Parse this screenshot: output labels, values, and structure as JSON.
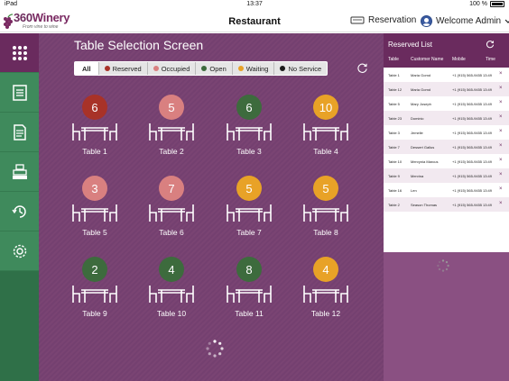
{
  "status_bar": {
    "device": "iPad",
    "time": "13:37",
    "battery": "100 %"
  },
  "header": {
    "logo_prefix": "360",
    "logo_name": "Winery",
    "logo_tagline": "From vine to wine",
    "title": "Restaurant",
    "reservation_label": "Reservation",
    "admin_label": "Welcome Admin"
  },
  "sidebar": {
    "items": [
      {
        "name": "grid-icon",
        "active": true
      },
      {
        "name": "list-icon",
        "active": false
      },
      {
        "name": "document-icon",
        "active": false
      },
      {
        "name": "register-icon",
        "active": false
      },
      {
        "name": "history-icon",
        "active": false
      },
      {
        "name": "gear-icon",
        "active": false
      }
    ]
  },
  "main": {
    "title": "Table Selection Screen",
    "filters": [
      {
        "label": "All",
        "color": null,
        "active": true
      },
      {
        "label": "Reserved",
        "color": "#a83228",
        "active": false
      },
      {
        "label": "Occupied",
        "color": "#d98080",
        "active": false
      },
      {
        "label": "Open",
        "color": "#3d6b3d",
        "active": false
      },
      {
        "label": "Waiting",
        "color": "#e8a227",
        "active": false
      },
      {
        "label": "No Service",
        "color": "#1a1a1a",
        "active": false
      }
    ],
    "tables": [
      {
        "count": "6",
        "name": "Table 1",
        "color": "#a83228"
      },
      {
        "count": "5",
        "name": "Table 2",
        "color": "#d98080"
      },
      {
        "count": "6",
        "name": "Table 3",
        "color": "#3d6b3d"
      },
      {
        "count": "10",
        "name": "Table 4",
        "color": "#e8a227"
      },
      {
        "count": "3",
        "name": "Table 5",
        "color": "#d98080"
      },
      {
        "count": "7",
        "name": "Table 6",
        "color": "#d98080"
      },
      {
        "count": "5",
        "name": "Table 7",
        "color": "#e8a227"
      },
      {
        "count": "5",
        "name": "Table 8",
        "color": "#e8a227"
      },
      {
        "count": "2",
        "name": "Table 9",
        "color": "#3d6b3d"
      },
      {
        "count": "4",
        "name": "Table 10",
        "color": "#3d6b3d"
      },
      {
        "count": "8",
        "name": "Table 11",
        "color": "#3d6b3d"
      },
      {
        "count": "4",
        "name": "Table 12",
        "color": "#e8a227"
      }
    ]
  },
  "reserved": {
    "title": "Reserved List",
    "columns": [
      "Table",
      "Customer Name",
      "Mobile",
      "Time"
    ],
    "rows": [
      {
        "table": "Table 1",
        "name": "Maria Gomd",
        "mobile": "+1 (915) 565-9455",
        "time": "13:49"
      },
      {
        "table": "Table 12",
        "name": "Maria Gomd",
        "mobile": "+1 (915) 565-9455",
        "time": "13:49"
      },
      {
        "table": "Table 5",
        "name": "Mary Joseph",
        "mobile": "+1 (915) 565-9455",
        "time": "13:49"
      },
      {
        "table": "Table 23",
        "name": "Dominic",
        "mobile": "+1 (915) 565-9455",
        "time": "13:49"
      },
      {
        "table": "Table 3",
        "name": "Jemelle",
        "mobile": "+1 (915) 565-9455",
        "time": "13:49"
      },
      {
        "table": "Table 7",
        "name": "Dessert Gallus",
        "mobile": "+1 (915) 565-9455",
        "time": "13:49"
      },
      {
        "table": "Table 10",
        "name": "Mervynia Marcus",
        "mobile": "+1 (915) 565-9455",
        "time": "13:49"
      },
      {
        "table": "Table 9",
        "name": "Mervina",
        "mobile": "+1 (915) 565-9455",
        "time": "13:49"
      },
      {
        "table": "Table 16",
        "name": "Len",
        "mobile": "+1 (915) 565-9455",
        "time": "13:49"
      },
      {
        "table": "Table 2",
        "name": "Season Thomas",
        "mobile": "+1 (915) 565-9455",
        "time": "13:49"
      }
    ]
  }
}
